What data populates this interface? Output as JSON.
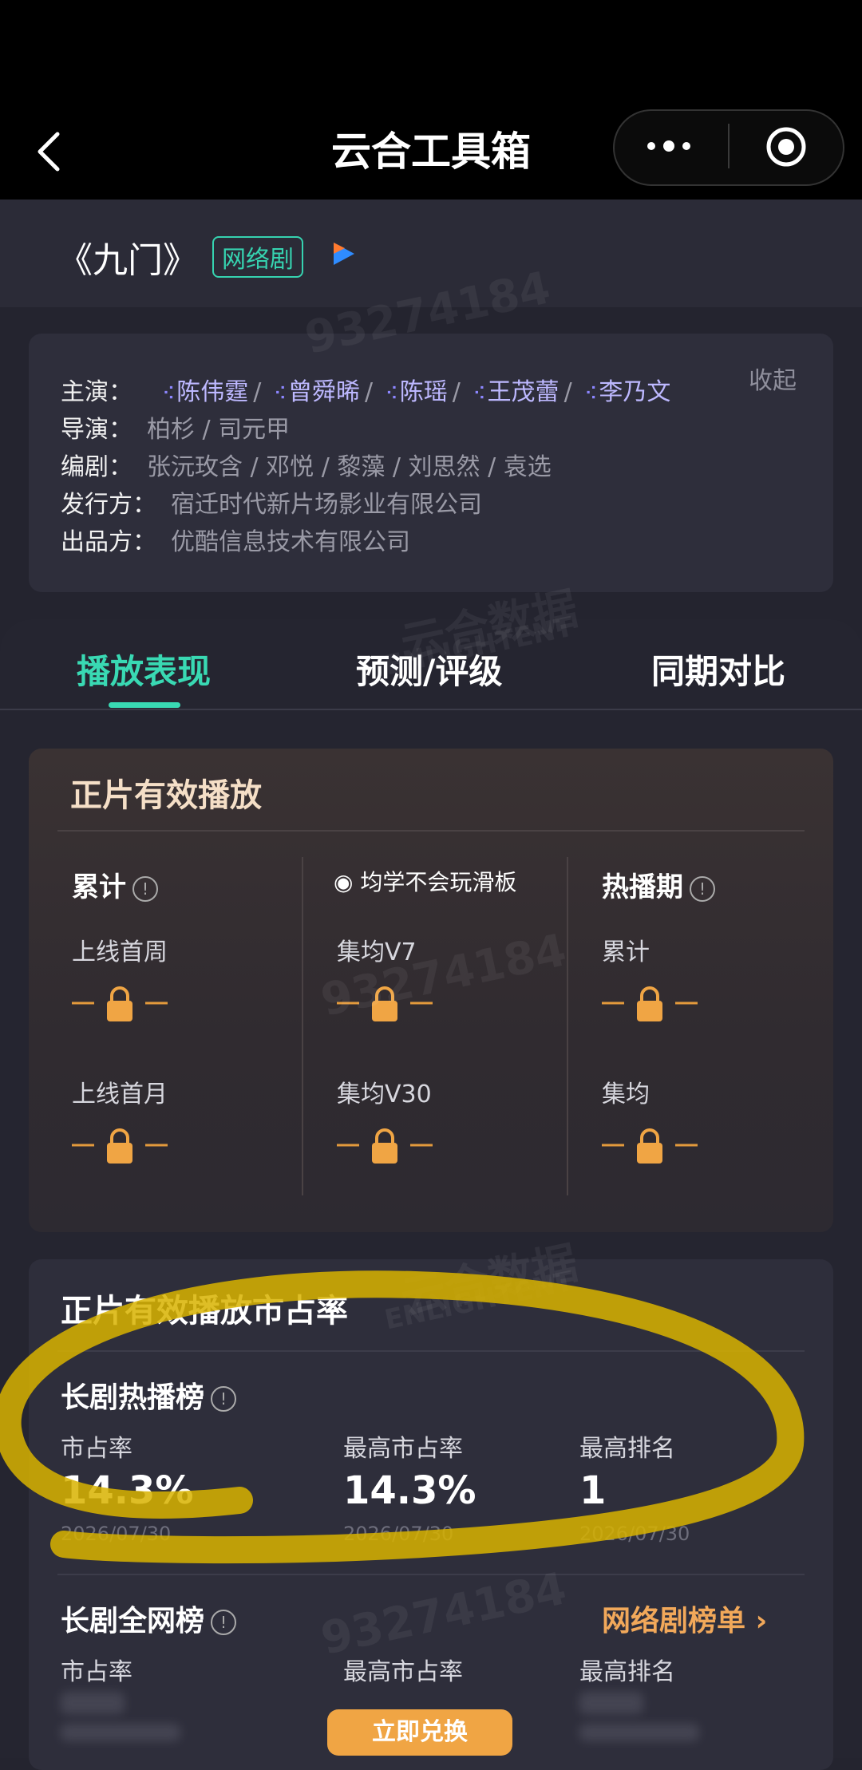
{
  "nav": {
    "title": "云合工具箱"
  },
  "header": {
    "drama_name": "《九门》",
    "type_badge": "网络剧"
  },
  "cast": {
    "lead_label": "主演：",
    "actors": [
      "陈伟霆",
      "曾舜晞",
      "陈瑶",
      "王茂蕾",
      "李乃文"
    ],
    "director_label": "导演：",
    "director_value": "柏杉 / 司元甲",
    "writer_label": "编剧：",
    "writer_value": "张沅玫含 / 邓悦 / 黎藻 / 刘思然 / 袁选",
    "distributor_label": "发行方：",
    "distributor_value": "宿迁时代新片场影业有限公司",
    "producer_label": "出品方：",
    "producer_value": "优酷信息技术有限公司",
    "collapse_label": "收起"
  },
  "tabs": [
    "播放表现",
    "预测/评级",
    "同期对比"
  ],
  "effective_play": {
    "title": "正片有效播放",
    "col1": {
      "head": "累计",
      "label1": "上线首周",
      "label2": "上线首月"
    },
    "col2": {
      "label1": "集均V7",
      "label2": "集均V30"
    },
    "col3": {
      "head": "热播期",
      "label1": "累计",
      "label2": "集均"
    }
  },
  "overlay_tag": "均学不会玩滑板",
  "watermarks": [
    "93274184",
    "云合数据",
    "ENLIGHTENT"
  ],
  "market_share": {
    "title": "正片有效播放市占率",
    "hot": {
      "title": "长剧热播榜",
      "share_label": "市占率",
      "share_value": "14.3%",
      "share_date": "2026/07/30",
      "max_label": "最高市占率",
      "max_value": "14.3%",
      "max_date": "2026/07/30",
      "rank_label": "最高排名",
      "rank_value": "1",
      "rank_date": "2026/07/30"
    },
    "net": {
      "title": "长剧全网榜",
      "link": "网络剧榜单",
      "share_label": "市占率",
      "max_label": "最高市占率",
      "rank_label": "最高排名"
    },
    "redeem_label": "立即兑换"
  },
  "colors": {
    "accent": "#39d9b3",
    "orange": "#f0a544",
    "actor": "#bdb8ff"
  }
}
